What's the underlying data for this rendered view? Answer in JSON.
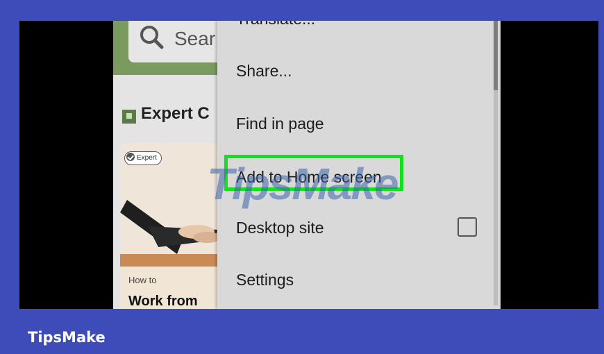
{
  "search": {
    "placeholder": "Sear"
  },
  "section": {
    "title": "Expert C"
  },
  "card": {
    "badge": "Expert",
    "meta": "How to",
    "title": "Work from"
  },
  "menu": {
    "items": [
      {
        "label": "Translate..."
      },
      {
        "label": "Share..."
      },
      {
        "label": "Find in page"
      },
      {
        "label": "Add to Home screen"
      },
      {
        "label": "Desktop site",
        "checked": false
      },
      {
        "label": "Settings"
      }
    ]
  },
  "watermark": "TipsMake",
  "brand": "TipsMake",
  "colors": {
    "background": "#3d4cb9",
    "highlight": "#14e020",
    "menu": "#d9d9d9"
  }
}
